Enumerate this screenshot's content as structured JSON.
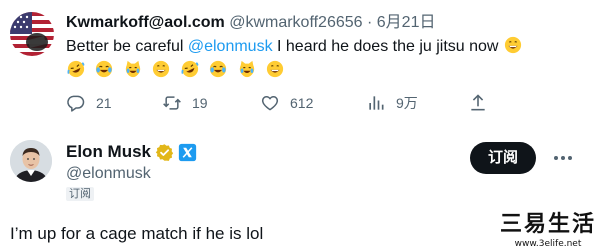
{
  "reply_tweet": {
    "display_name": "Kwmarkoff@aol.com",
    "handle": "@kwmarkoff26656",
    "separator": "·",
    "date": "6月21日",
    "text_before": "Better be careful ",
    "mention": "@elonmusk",
    "text_after": " I heard he does the ju jitsu now",
    "emoji_sequence": [
      "grinning-face",
      "rolling-laughing",
      "tears-of-joy",
      "grinning-cat",
      "grinning-face",
      "rolling-laughing",
      "tears-of-joy",
      "grinning-cat",
      "grinning-face"
    ],
    "actions": {
      "replies": "21",
      "retweets": "19",
      "likes": "612",
      "views": "9万"
    }
  },
  "main_tweet": {
    "display_name": "Elon Musk",
    "handle": "@elonmusk",
    "subscriber_tag": "订阅",
    "subscribe_button": "订阅",
    "text": "I’m up for a cage match if he is lol",
    "badges": [
      "verified-gold-icon",
      "x-logo-icon"
    ]
  },
  "watermark": {
    "title": "三易生活",
    "url": "www.3elife.net"
  },
  "colors": {
    "accent": "#1d9bf0",
    "secondary_text": "#536471",
    "primary_text": "#0f1419",
    "verified_gold": "#e2b719",
    "button_bg": "#0f1419"
  }
}
